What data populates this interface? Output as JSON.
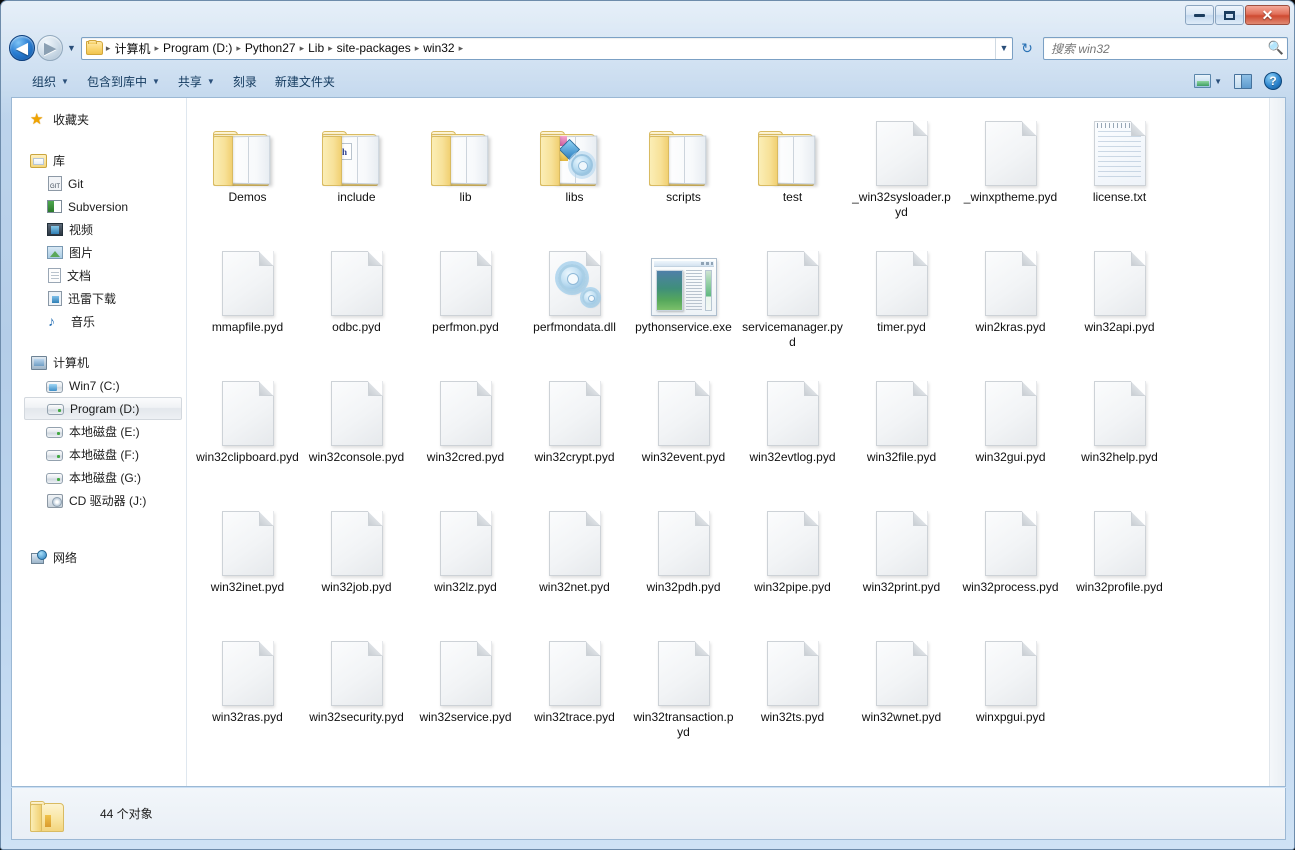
{
  "window": {
    "minimize_label": "Minimize",
    "maximize_label": "Maximize",
    "close_label": "Close"
  },
  "navigation": {
    "back_label": "◀",
    "forward_label": "▶",
    "history_caret": "▼",
    "breadcrumbs": [
      "计算机",
      "Program (D:)",
      "Python27",
      "Lib",
      "site-packages",
      "win32"
    ],
    "separator": "▸",
    "address_dropdown": "▼",
    "refresh_label": "↻"
  },
  "search": {
    "placeholder": "搜索 win32",
    "icon": "search-icon"
  },
  "toolbar": {
    "items": [
      {
        "label": "组织",
        "has_caret": true
      },
      {
        "label": "包含到库中",
        "has_caret": true
      },
      {
        "label": "共享",
        "has_caret": true
      },
      {
        "label": "刻录",
        "has_caret": false
      },
      {
        "label": "新建文件夹",
        "has_caret": false
      }
    ],
    "view_caret": "▼",
    "help_label": "?"
  },
  "sidebar": {
    "groups": [
      {
        "header": {
          "label": "收藏夹",
          "icon": "star-icon"
        },
        "items": []
      },
      {
        "header": {
          "label": "库",
          "icon": "library-icon"
        },
        "items": [
          {
            "label": "Git",
            "icon": "git-icon"
          },
          {
            "label": "Subversion",
            "icon": "subversion-icon"
          },
          {
            "label": "视频",
            "icon": "video-icon"
          },
          {
            "label": "图片",
            "icon": "picture-icon"
          },
          {
            "label": "文档",
            "icon": "document-icon"
          },
          {
            "label": "迅雷下载",
            "icon": "download-icon"
          },
          {
            "label": "音乐",
            "icon": "music-icon"
          }
        ]
      },
      {
        "header": {
          "label": "计算机",
          "icon": "computer-icon"
        },
        "items": [
          {
            "label": "Win7 (C:)",
            "icon": "system-drive-icon",
            "selected": false
          },
          {
            "label": "Program (D:)",
            "icon": "drive-icon",
            "selected": true
          },
          {
            "label": "本地磁盘 (E:)",
            "icon": "drive-icon",
            "selected": false
          },
          {
            "label": "本地磁盘 (F:)",
            "icon": "drive-icon",
            "selected": false
          },
          {
            "label": "本地磁盘 (G:)",
            "icon": "drive-icon",
            "selected": false
          },
          {
            "label": "CD 驱动器 (J:)",
            "icon": "cd-drive-icon",
            "selected": false
          }
        ]
      },
      {
        "header": {
          "label": "网络",
          "icon": "network-icon"
        },
        "items": []
      }
    ]
  },
  "files": [
    {
      "name": "Demos",
      "type": "folder"
    },
    {
      "name": "include",
      "type": "folder-h"
    },
    {
      "name": "lib",
      "type": "folder"
    },
    {
      "name": "libs",
      "type": "folder-content"
    },
    {
      "name": "scripts",
      "type": "folder"
    },
    {
      "name": "test",
      "type": "folder"
    },
    {
      "name": "_win32sysloader.pyd",
      "type": "file"
    },
    {
      "name": "_winxptheme.pyd",
      "type": "file"
    },
    {
      "name": "license.txt",
      "type": "text"
    },
    {
      "name": "mmapfile.pyd",
      "type": "file"
    },
    {
      "name": "odbc.pyd",
      "type": "file"
    },
    {
      "name": "perfmon.pyd",
      "type": "file"
    },
    {
      "name": "perfmondata.dll",
      "type": "dll"
    },
    {
      "name": "pythonservice.exe",
      "type": "exe"
    },
    {
      "name": "servicemanager.pyd",
      "type": "file"
    },
    {
      "name": "timer.pyd",
      "type": "file"
    },
    {
      "name": "win2kras.pyd",
      "type": "file"
    },
    {
      "name": "win32api.pyd",
      "type": "file"
    },
    {
      "name": "win32clipboard.pyd",
      "type": "file"
    },
    {
      "name": "win32console.pyd",
      "type": "file"
    },
    {
      "name": "win32cred.pyd",
      "type": "file"
    },
    {
      "name": "win32crypt.pyd",
      "type": "file"
    },
    {
      "name": "win32event.pyd",
      "type": "file"
    },
    {
      "name": "win32evtlog.pyd",
      "type": "file"
    },
    {
      "name": "win32file.pyd",
      "type": "file"
    },
    {
      "name": "win32gui.pyd",
      "type": "file"
    },
    {
      "name": "win32help.pyd",
      "type": "file"
    },
    {
      "name": "win32inet.pyd",
      "type": "file"
    },
    {
      "name": "win32job.pyd",
      "type": "file"
    },
    {
      "name": "win32lz.pyd",
      "type": "file"
    },
    {
      "name": "win32net.pyd",
      "type": "file"
    },
    {
      "name": "win32pdh.pyd",
      "type": "file"
    },
    {
      "name": "win32pipe.pyd",
      "type": "file"
    },
    {
      "name": "win32print.pyd",
      "type": "file"
    },
    {
      "name": "win32process.pyd",
      "type": "file"
    },
    {
      "name": "win32profile.pyd",
      "type": "file"
    },
    {
      "name": "win32ras.pyd",
      "type": "file"
    },
    {
      "name": "win32security.pyd",
      "type": "file"
    },
    {
      "name": "win32service.pyd",
      "type": "file"
    },
    {
      "name": "win32trace.pyd",
      "type": "file"
    },
    {
      "name": "win32transaction.pyd",
      "type": "file"
    },
    {
      "name": "win32ts.pyd",
      "type": "file"
    },
    {
      "name": "win32wnet.pyd",
      "type": "file"
    },
    {
      "name": "winxpgui.pyd",
      "type": "file"
    }
  ],
  "statusbar": {
    "text": "44 个对象"
  },
  "colors": {
    "accent_blue": "#2a72b5",
    "frame_glass": "#b4cde8",
    "folder_yellow": "#f9e6a4",
    "selection_border": "#d3d8de"
  }
}
